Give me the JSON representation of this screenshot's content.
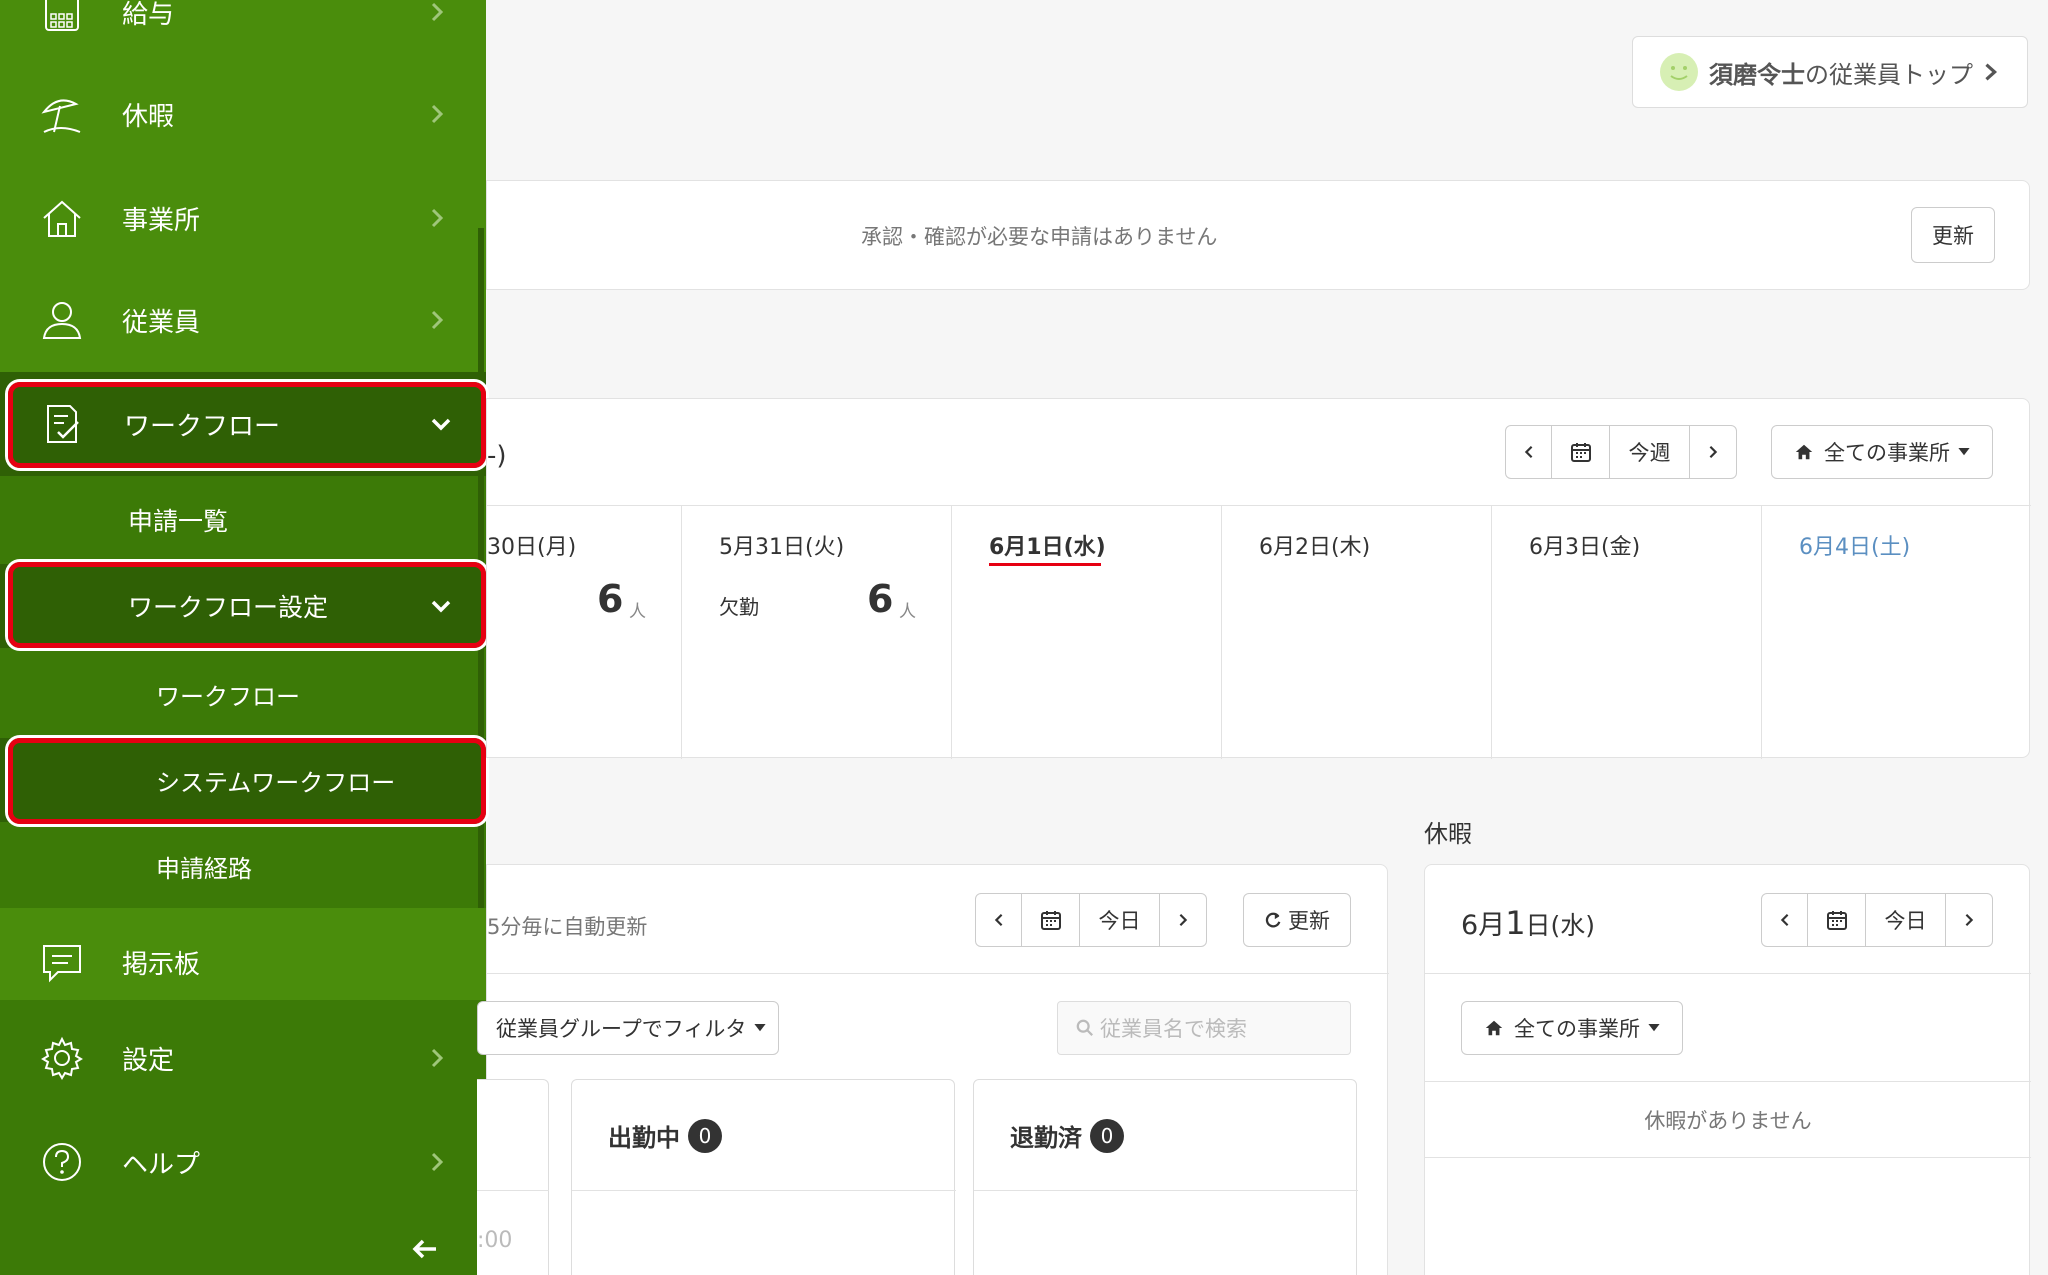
{
  "sidebar": {
    "items": [
      {
        "label": "給与",
        "icon": "calculator-icon"
      },
      {
        "label": "休暇",
        "icon": "beach-umbrella-icon"
      },
      {
        "label": "事業所",
        "icon": "home-icon"
      },
      {
        "label": "従業員",
        "icon": "person-icon"
      },
      {
        "label": "ワークフロー",
        "icon": "checklist-icon"
      },
      {
        "label": "掲示板",
        "icon": "message-board-icon"
      },
      {
        "label": "設定",
        "icon": "gear-icon"
      },
      {
        "label": "ヘルプ",
        "icon": "help-icon"
      }
    ],
    "workflow_sub": {
      "list": "申請一覧",
      "settings": "ワークフロー設定",
      "workflow": "ワークフロー",
      "system_workflow": "システムワークフロー",
      "route": "申請経路"
    },
    "colors": {
      "sidebar": "#4a8d0c",
      "active": "#2f6005",
      "highlight": "#e60012"
    }
  },
  "header": {
    "employee_top_name": "須磨令士",
    "employee_top_suffix": "の従業員トップ"
  },
  "approvals": {
    "message": "承認・確認が必要な申請はありません",
    "refresh_label": "更新"
  },
  "week": {
    "title_fragment": "-)",
    "this_week_label": "今週",
    "office_filter": "全ての事業所",
    "days": [
      {
        "label": "30日(月)",
        "count": "6",
        "unit": "人"
      },
      {
        "label": "5月31日(火)",
        "type": "欠勤",
        "count": "6",
        "unit": "人"
      },
      {
        "label": "6月1日(水)"
      },
      {
        "label": "6月2日(木)"
      },
      {
        "label": "6月3日(金)"
      },
      {
        "label": "6月4日(土)"
      }
    ]
  },
  "attendance": {
    "auto_update": "5分毎に自動更新",
    "today_label": "今日",
    "refresh_label": "更新",
    "group_filter": "従業員グループでフィルタ",
    "search_placeholder": "従業員名で検索",
    "columns": [
      {
        "label": "出勤中",
        "count": "0"
      },
      {
        "label": "退勤済",
        "count": "0"
      }
    ],
    "time_fragment": ":00"
  },
  "leave": {
    "section_title": "休暇",
    "date_prefix": "6月",
    "date_day": "1",
    "date_suffix": "日(水)",
    "today_label": "今日",
    "office_filter": "全ての事業所",
    "empty_message": "休暇がありません"
  }
}
